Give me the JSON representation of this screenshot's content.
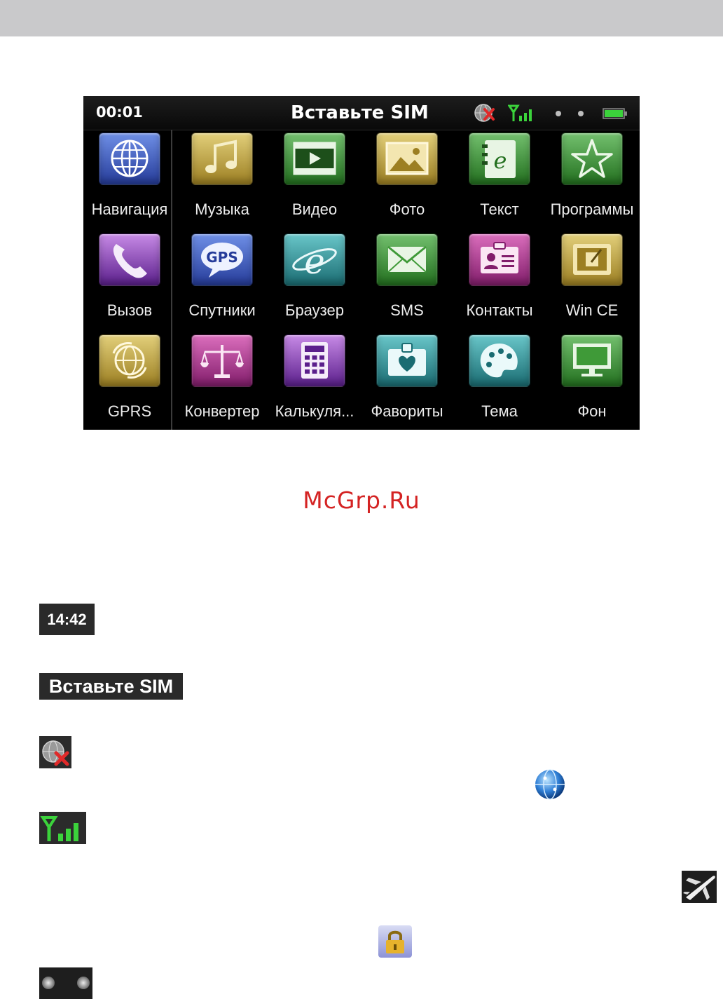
{
  "screen": {
    "status": {
      "time": "00:01",
      "title": "Вставьте SIM",
      "icons": [
        "gps-off-icon",
        "signal-icon",
        "dot-icon",
        "dot-icon",
        "battery-icon"
      ]
    },
    "apps": [
      {
        "label": "Навигация",
        "icon": "globe-icon",
        "color": "#3a56c0"
      },
      {
        "label": "Музыка",
        "icon": "music-note-icon",
        "color": "#c2a33e"
      },
      {
        "label": "Видео",
        "icon": "video-icon",
        "color": "#3f9a38"
      },
      {
        "label": "Фото",
        "icon": "photo-icon",
        "color": "#c2a33e"
      },
      {
        "label": "Текст",
        "icon": "text-book-icon",
        "color": "#3f9a38"
      },
      {
        "label": "Программы",
        "icon": "star-icon",
        "color": "#3f9a38"
      },
      {
        "label": "Вызов",
        "icon": "phone-icon",
        "color": "#8a3cb8"
      },
      {
        "label": "Спутники",
        "icon": "gps-bubble-icon",
        "color": "#3a56c0"
      },
      {
        "label": "Браузер",
        "icon": "browser-e-icon",
        "color": "#2a8e94"
      },
      {
        "label": "SMS",
        "icon": "envelope-icon",
        "color": "#3f9a38"
      },
      {
        "label": "Контакты",
        "icon": "contact-card-icon",
        "color": "#b23c93"
      },
      {
        "label": "Win CE",
        "icon": "win-ce-icon",
        "color": "#c2a33e"
      },
      {
        "label": "GPRS",
        "icon": "gprs-globe-icon",
        "color": "#c2a33e"
      },
      {
        "label": "Конвертер",
        "icon": "scales-icon",
        "color": "#b23c93"
      },
      {
        "label": "Калькуля...",
        "icon": "calculator-icon",
        "color": "#8a3cb8"
      },
      {
        "label": "Фавориты",
        "icon": "favorites-heart-icon",
        "color": "#2a8e94"
      },
      {
        "label": "Тема",
        "icon": "palette-icon",
        "color": "#2a8e94"
      },
      {
        "label": "Фон",
        "icon": "monitor-icon",
        "color": "#3f9a38"
      }
    ]
  },
  "watermark": "McGrp.Ru",
  "legend": {
    "clock": "14:42",
    "sim": "Вставьте SIM",
    "icons": [
      "gps-off-icon",
      "gps-on-icon",
      "signal-icon",
      "airplane-icon",
      "lock-icon",
      "dots-icon"
    ]
  }
}
